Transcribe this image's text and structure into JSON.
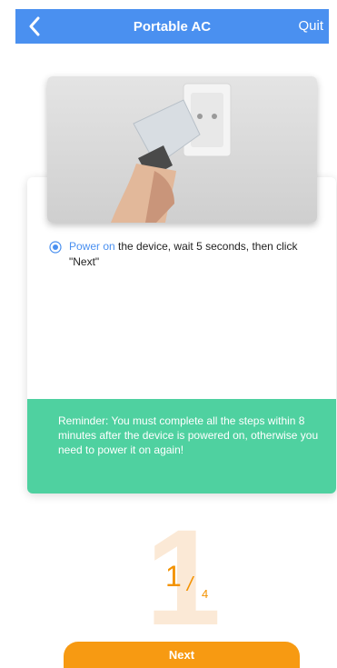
{
  "header": {
    "title": "Portable AC",
    "quit_label": "Quit",
    "back_icon": "chevron-left-icon",
    "bg_color": "#4a90f0"
  },
  "step": {
    "instruction_accent": "Power on",
    "instruction_rest": " the device, wait 5 seconds, then click \"Next\"",
    "reminder": "Reminder: You must complete all the steps within 8 minutes after the device is powered on, otherwise you need  to power it on again!",
    "reminder_color": "#4fd1a0"
  },
  "progress": {
    "current": "1",
    "total": "4",
    "accent_color": "#f39200"
  },
  "footer": {
    "next_label": "Next",
    "button_color": "#f79a12"
  }
}
